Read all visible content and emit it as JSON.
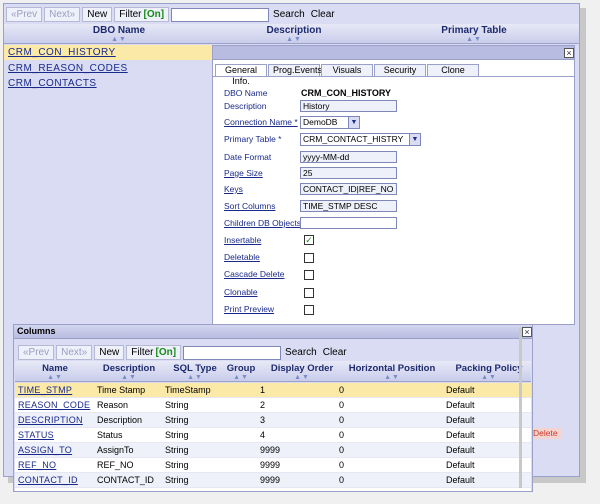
{
  "toolbar": {
    "prev": "«Prev",
    "next": "Next»",
    "new": "New",
    "filter": "Filter",
    "filter_state": "[On]",
    "search": "Search",
    "clear": "Clear"
  },
  "grid": {
    "headers": {
      "dbo_name": "DBO Name",
      "description": "Description",
      "primary_table": "Primary Table"
    },
    "rows": [
      {
        "name": "CRM_CON_HISTORY"
      },
      {
        "name": "CRM_REASON_CODES"
      },
      {
        "name": "CRM_CONTACTS"
      }
    ]
  },
  "detail": {
    "tabs": [
      "General Info.",
      "Prog.Events",
      "Visuals",
      "Security",
      "Clone"
    ],
    "labels": {
      "dbo_name": "DBO Name",
      "description": "Description",
      "connection_name": "Connection Name *",
      "primary_table": "Primary Table *",
      "date_format": "Date Format",
      "page_size": "Page Size",
      "keys": "Keys",
      "sort_columns": "Sort Columns",
      "children": "Children DB Objects",
      "insertable": "Insertable",
      "deletable": "Deletable",
      "cascade_delete": "Cascade Delete",
      "clonable": "Clonable",
      "print_preview": "Print Preview"
    },
    "values": {
      "dbo_name": "CRM_CON_HISTORY",
      "description": "History",
      "connection_name": "DemoDB",
      "primary_table": "CRM_CONTACT_HISTRY",
      "date_format": "yyyy-MM-dd",
      "page_size": "25",
      "keys": "CONTACT_ID|REF_NO",
      "sort_columns": "TIME_STMP DESC",
      "children": ""
    },
    "checks": {
      "insertable": true,
      "deletable": false,
      "cascade_delete": false,
      "clonable": false,
      "print_preview": false
    },
    "check_mark": "✓",
    "close": "×"
  },
  "delete_label": "Delete",
  "columns": {
    "title": "Columns",
    "close": "×",
    "toolbar": {
      "prev": "«Prev",
      "next": "Next»",
      "new": "New",
      "filter": "Filter",
      "filter_state": "[On]",
      "search": "Search",
      "clear": "Clear"
    },
    "headers": [
      "Name",
      "Description",
      "SQL Type",
      "Group",
      "Display Order",
      "Horizontal Position",
      "Packing Policy"
    ],
    "rows": [
      {
        "name": "TIME_STMP",
        "description": "Time Stamp",
        "sql_type": "TimeStamp",
        "group": "",
        "order": "1",
        "hpos": "0",
        "policy": "Default"
      },
      {
        "name": "REASON_CODE",
        "description": "Reason",
        "sql_type": "String",
        "group": "",
        "order": "2",
        "hpos": "0",
        "policy": "Default"
      },
      {
        "name": "DESCRIPTION",
        "description": "Description",
        "sql_type": "String",
        "group": "",
        "order": "3",
        "hpos": "0",
        "policy": "Default"
      },
      {
        "name": "STATUS",
        "description": "Status",
        "sql_type": "String",
        "group": "",
        "order": "4",
        "hpos": "0",
        "policy": "Default"
      },
      {
        "name": "ASSIGN_TO",
        "description": "AssignTo",
        "sql_type": "String",
        "group": "",
        "order": "9999",
        "hpos": "0",
        "policy": "Default"
      },
      {
        "name": "REF_NO",
        "description": "REF_NO",
        "sql_type": "String",
        "group": "",
        "order": "9999",
        "hpos": "0",
        "policy": "Default"
      },
      {
        "name": "CONTACT_ID",
        "description": "CONTACT_ID",
        "sql_type": "String",
        "group": "",
        "order": "9999",
        "hpos": "0",
        "policy": "Default"
      }
    ]
  },
  "icons": {
    "sort": "sort-arrows-icon",
    "close": "close-icon",
    "check": "checkmark-icon",
    "dropdown": "chevron-down-icon"
  },
  "colors": {
    "link": "#1a2a8a",
    "selected_row": "#fbe9a8",
    "panel_bg": "#d9dcf2",
    "filter_on": "#1a8a1a",
    "delete": "#cc3a2a"
  }
}
